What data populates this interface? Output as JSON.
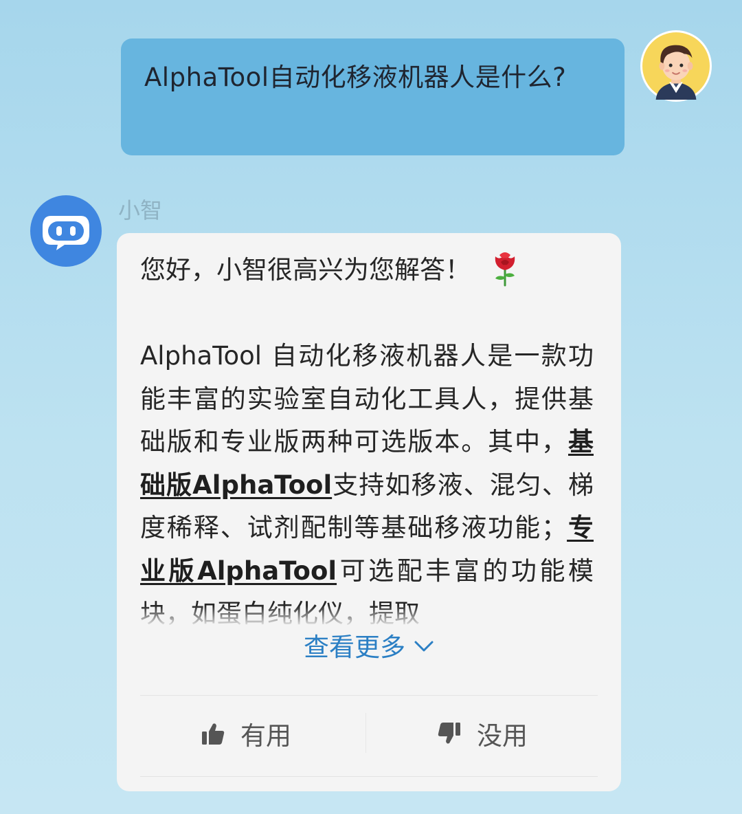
{
  "colors": {
    "user_bubble": "#67b5df",
    "bot_card": "#f4f4f4",
    "link_blue": "#2b7fc4",
    "bot_avatar_blue": "#3f86e0",
    "user_avatar_yellow": "#f7d65a"
  },
  "user_message": {
    "text": "AlphaTool自动化移液机器人是什么?",
    "avatar": "user-avatar-icon"
  },
  "bot": {
    "name": "小智",
    "avatar": "robot-icon",
    "greeting": "您好，小智很高兴为您解答！",
    "greeting_emoji": "rose-icon",
    "answer": {
      "part1": "AlphaTool 自动化移液机器人是一款功能丰富的实验室自动化工具人，提供基础版和专业版两种可选版本。其中，",
      "link1": "基础版AlphaTool",
      "part2": "支持如移液、混匀、梯度稀释、试剂配制等基础移液功能；",
      "link2": "专业版AlphaTool",
      "part3": "可选配丰富的功能模块，如蛋白纯化仪，提取"
    },
    "see_more": "查看更多",
    "feedback": {
      "useful": "有用",
      "useless": "没用"
    }
  }
}
